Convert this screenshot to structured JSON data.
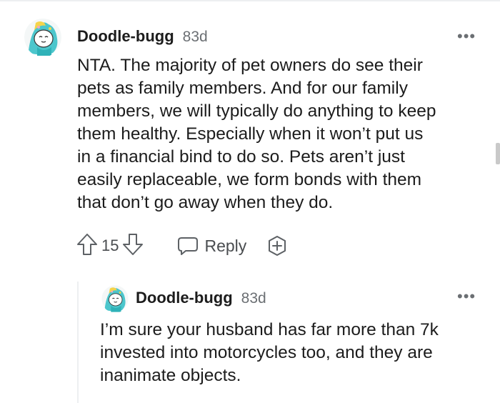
{
  "comments": [
    {
      "username": "Doodle-bugg",
      "timestamp": "83d",
      "more": "•••",
      "lines": [
        "NTA. The majority of pet owners do see their",
        "pets as family members. And for our family",
        "members, we will typically do anything to keep",
        "them healthy. Especially when it won’t put us",
        "in a financial bind to do so. Pets aren’t just",
        "easily replaceable, we form bonds with them",
        "that don’t go away when they do."
      ],
      "vote_count": "15",
      "reply_label": "Reply"
    },
    {
      "username": "Doodle-bugg",
      "timestamp": "83d",
      "more": "•••",
      "lines": [
        "I’m sure your husband has far more than 7k",
        "invested into motorcycles too, and they are",
        "inanimate objects."
      ]
    }
  ],
  "icons": {
    "upvote": "upvote-arrow-icon",
    "downvote": "downvote-arrow-icon",
    "reply": "speech-bubble-icon",
    "award": "award-plus-icon",
    "more": "more-dots-icon",
    "avatar": "snoo-avatar-icon"
  },
  "colors": {
    "text": "#1c1c1c",
    "meta": "#6b6f73",
    "avatar_accent": "#45c3c9"
  }
}
